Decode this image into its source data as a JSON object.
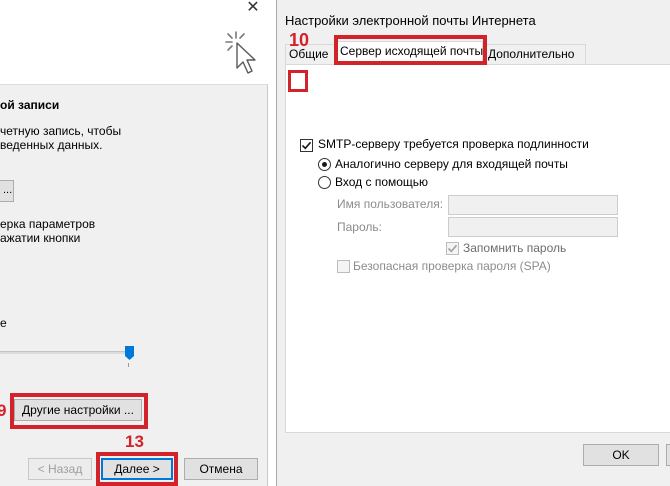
{
  "left_dialog": {
    "heading": "ой записи",
    "desc_line1": "четную запись, чтобы",
    "desc_line2": "веденных данных.",
    "small_button_label": "...",
    "test_line1": "ерка параметров",
    "test_line2": "ажатии кнопки",
    "e_text": "е",
    "slider_value_percent": 100,
    "more_settings_label": "Другие настройки ...",
    "back_label": "< Назад",
    "next_label": "Далее >",
    "cancel_label": "Отмена",
    "close_glyph": "✕"
  },
  "right_dialog": {
    "title": "Настройки электронной почты Интернета",
    "tabs": [
      {
        "label": "Общие",
        "selected": false
      },
      {
        "label": "Сервер исходящей почты",
        "selected": true
      },
      {
        "label": "Дополнительно",
        "selected": false
      }
    ],
    "smtp_auth_label": "SMTP-серверу требуется проверка подлинности",
    "smtp_auth_checked": true,
    "radio_same_label": "Аналогично серверу для входящей почты",
    "radio_same_selected": true,
    "radio_login_label": "Вход с помощью",
    "radio_login_selected": false,
    "username_label": "Имя пользователя:",
    "username_value": "",
    "password_label": "Пароль:",
    "password_value": "",
    "remember_label": "Запомнить пароль",
    "remember_checked": true,
    "spa_label": "Безопасная проверка пароля (SPA)",
    "spa_checked": false,
    "ok_label": "OK"
  },
  "annotations": {
    "step_9": "9",
    "step_10": "10",
    "step_13": "13",
    "color": "#d2232a"
  }
}
